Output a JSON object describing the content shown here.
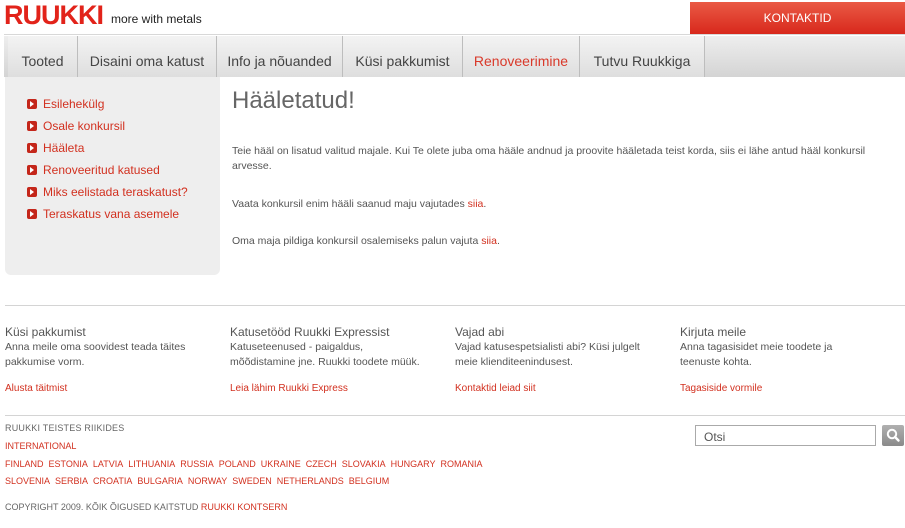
{
  "header": {
    "logo_text": "RUUKKI",
    "tagline": "more with metals",
    "contact_button": "KONTAKTID"
  },
  "nav": {
    "tabs": [
      {
        "label": "Tooted"
      },
      {
        "label": "Disaini oma katust"
      },
      {
        "label": "Info ja nõuanded"
      },
      {
        "label": "Küsi pakkumist"
      },
      {
        "label": "Renoveerimine"
      },
      {
        "label": "Tutvu Ruukkiga"
      }
    ],
    "active_color": "#d9392a"
  },
  "sidebar": {
    "items": [
      {
        "label": "Esilehekülg"
      },
      {
        "label": "Osale konkursil"
      },
      {
        "label": "Hääleta"
      },
      {
        "label": "Renoveeritud katused"
      },
      {
        "label": "Miks eelistada teraskatust?"
      },
      {
        "label": "Teraskatus vana asemele"
      }
    ]
  },
  "main": {
    "title": "Hääletatud!",
    "para1": "Teie hääl on lisatud valitud majale. Kui Te olete juba oma hääle andnud ja proovite hääletada teist korda, siis ei lähe antud hääl konkursil arvesse.",
    "para2_text": "Vaata konkursil enim hääli saanud maju vajutades ",
    "para2_link": "siia",
    "para3_text": "Oma maja pildiga konkursil osalemiseks palun vajuta ",
    "para3_link": "siia",
    "period": "."
  },
  "footer": {
    "columns": [
      {
        "title": "Küsi pakkumist",
        "text": "Anna meile oma soovidest teada täites pakkumise vorm.",
        "link": "Alusta täitmist"
      },
      {
        "title": "Katusetööd Ruukki Expressist",
        "text": "Katuseteenused - paigaldus, mõõdistamine jne. Ruukki toodete müük.",
        "link": "Leia lähim Ruukki Express"
      },
      {
        "title": "Vajad abi",
        "text": "Vajad katusespetsialisti abi? Küsi julgelt meie klienditeenindusest.",
        "link": "Kontaktid leiad siit"
      },
      {
        "title": "Kirjuta meile",
        "text": "Anna tagasisidet meie toodete ja teenuste kohta.",
        "link": "Tagasiside vormile"
      }
    ],
    "countries_heading": "RUUKKI TEISTES RIIKIDES",
    "international": "INTERNATIONAL",
    "countries_row1": [
      "FINLAND",
      "ESTONIA",
      "LATVIA",
      "LITHUANIA",
      "RUSSIA",
      "POLAND",
      "UKRAINE",
      "CZECH",
      "SLOVAKIA",
      "HUNGARY",
      "ROMANIA"
    ],
    "countries_row2": [
      "SLOVENIA",
      "SERBIA",
      "CROATIA",
      "BULGARIA",
      "NORWAY",
      "SWEDEN",
      "NETHERLANDS",
      "BELGIUM"
    ],
    "copyright_text": "COPYRIGHT 2009. KÕIK ÕIGUSED KAITSTUD ",
    "copyright_link": "RUUKKI KONTSERN",
    "search_placeholder": "Otsi",
    "search_icon": "magnifier-icon"
  },
  "colors": {
    "brand_red": "#e2231a",
    "link_red": "#d2301f"
  }
}
